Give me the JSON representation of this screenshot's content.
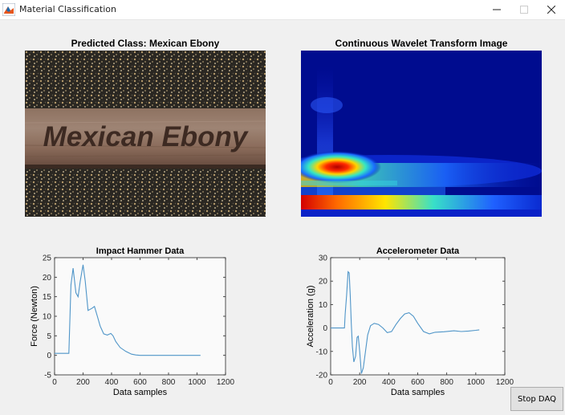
{
  "window": {
    "title": "Material Classification",
    "minimize_icon": "minimize-icon",
    "maximize_icon": "maximize-icon",
    "close_icon": "close-icon"
  },
  "colors": {
    "line": "#4f95c8",
    "axis_bg": "#fafafa",
    "window_bg": "#f0f0f0"
  },
  "predicted": {
    "title": "Predicted Class: Mexican Ebony",
    "board_text": "Mexican Ebony"
  },
  "cwt": {
    "title": "Continuous Wavelet Transform Image"
  },
  "controls": {
    "stop_label": "Stop DAQ"
  },
  "chart_data": [
    {
      "type": "line",
      "title": "Impact Hammer Data",
      "xlabel": "Data samples",
      "ylabel": "Force (Newton)",
      "xlim": [
        0,
        1200
      ],
      "ylim": [
        -5,
        25
      ],
      "xticks": [
        0,
        200,
        400,
        600,
        800,
        1000,
        1200
      ],
      "yticks": [
        -5,
        0,
        5,
        10,
        15,
        20,
        25
      ],
      "grid": false,
      "series": [
        {
          "x": [
            0,
            100,
            115,
            130,
            150,
            165,
            180,
            200,
            215,
            235,
            260,
            280,
            300,
            320,
            345,
            370,
            395,
            410,
            430,
            460,
            500,
            540,
            570,
            600,
            700,
            800,
            900,
            1000,
            1024
          ],
          "y": [
            0.5,
            0.5,
            18,
            22.3,
            16,
            15,
            19,
            23.2,
            19,
            11.5,
            12,
            12.5,
            10,
            7.5,
            5.5,
            5.2,
            5.6,
            5,
            3.5,
            2,
            1,
            0.3,
            0.1,
            0,
            0,
            0,
            0,
            0,
            0
          ]
        }
      ]
    },
    {
      "type": "line",
      "title": "Accelerometer Data",
      "xlabel": "Data samples",
      "ylabel": "Acceleration (g)",
      "xlim": [
        0,
        1200
      ],
      "ylim": [
        -20,
        30
      ],
      "xticks": [
        0,
        200,
        400,
        600,
        800,
        1000,
        1200
      ],
      "yticks": [
        -20,
        -10,
        0,
        10,
        20,
        30
      ],
      "grid": false,
      "series": [
        {
          "x": [
            0,
            95,
            100,
            110,
            120,
            128,
            135,
            142,
            150,
            160,
            172,
            182,
            190,
            200,
            212,
            225,
            240,
            255,
            275,
            300,
            330,
            360,
            390,
            420,
            450,
            480,
            510,
            540,
            570,
            600,
            640,
            680,
            720,
            780,
            850,
            900,
            950,
            1000,
            1024
          ],
          "y": [
            0,
            0,
            6,
            14,
            24,
            23.5,
            14,
            2,
            -8,
            -14.5,
            -12,
            -4,
            -3.5,
            -10,
            -19.5,
            -17,
            -10,
            -3,
            1,
            2,
            1.5,
            0,
            -2,
            -1.5,
            1.5,
            4,
            6,
            6.5,
            5,
            2,
            -1.5,
            -2.5,
            -1.8,
            -1.6,
            -1.2,
            -1.5,
            -1.3,
            -1,
            -0.8
          ]
        }
      ]
    }
  ]
}
